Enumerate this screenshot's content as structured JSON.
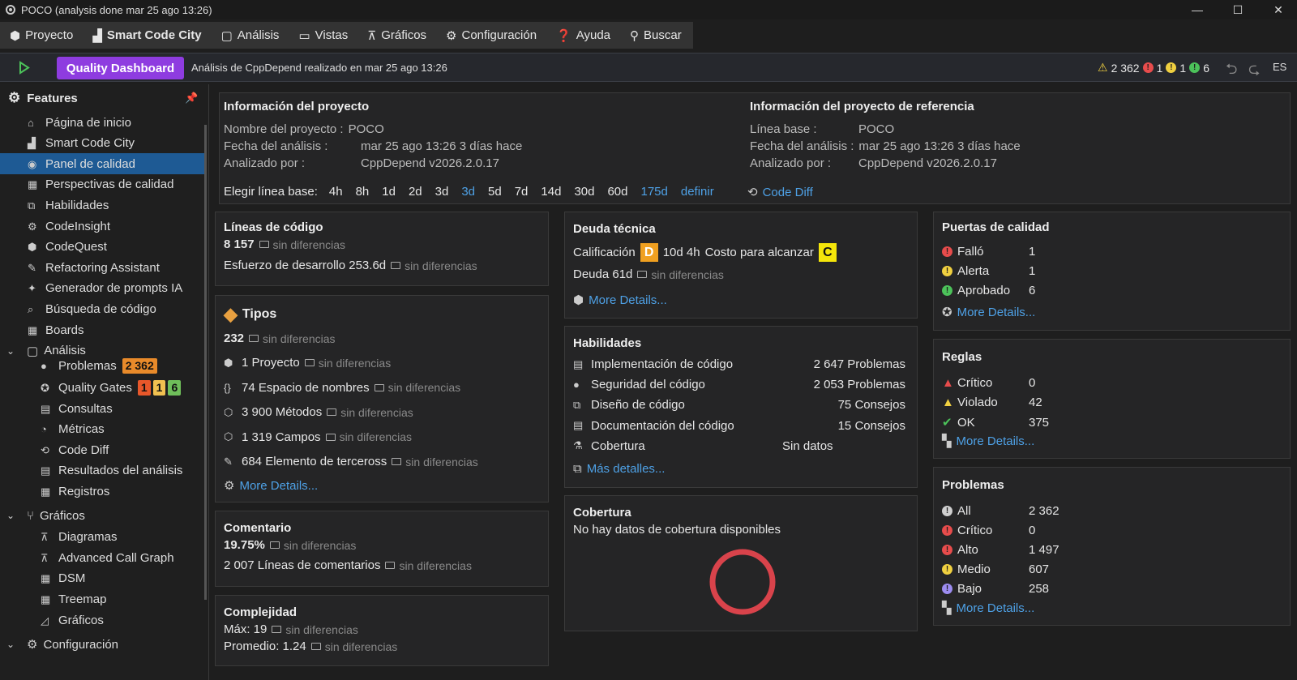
{
  "window": {
    "title": "POCO (analysis done mar 25 ago  13:26)"
  },
  "menu": [
    "Proyecto",
    "Smart Code City",
    "Análisis",
    "Vistas",
    "Gráficos",
    "Configuración",
    "Ayuda",
    "Buscar"
  ],
  "toolbar": {
    "quality_dashboard": "Quality Dashboard",
    "message": "Análisis de CppDepend realizado en mar 25 ago  13:26",
    "warn_count": "2 362",
    "red_count": "1",
    "yellow_count": "1",
    "green_count": "6",
    "lang": "ES"
  },
  "sidebar": {
    "header": "Features",
    "items": [
      "Página de inicio",
      "Smart Code City",
      "Panel de calidad",
      "Perspectivas de calidad",
      "Habilidades",
      "CodeInsight",
      "CodeQuest",
      "Refactoring Assistant",
      "Generador de prompts IA",
      "Búsqueda de código",
      "Boards"
    ],
    "analysis_group": "Análisis",
    "analysis_items": [
      "Problemas",
      "Quality Gates",
      "Consultas",
      "Métricas",
      "Code Diff",
      "Resultados del análisis",
      "Registros"
    ],
    "problems_badge": "2 362",
    "gates_badges": [
      "1",
      "1",
      "6"
    ],
    "graphs_group": "Gráficos",
    "graphs_items": [
      "Diagramas",
      "Advanced Call Graph",
      "DSM",
      "Treemap",
      "Gráficos"
    ],
    "config_group": "Configuración"
  },
  "project": {
    "title": "Información del proyecto",
    "name_label": "Nombre del proyecto :",
    "name_value": "POCO",
    "date_label": "Fecha del análisis :",
    "date_value": "mar 25 ago  13:26 3 días hace",
    "by_label": "Analizado por :",
    "by_value": "CppDepend v2026.2.0.17",
    "ref_title": "Información del proyecto de referencia",
    "base_label": "Línea base :",
    "base_value": "POCO",
    "ref_date_label": "Fecha del análisis :",
    "ref_date_value": "mar 25 ago  13:26 3 días hace",
    "ref_by_label": "Analizado por :",
    "ref_by_value": "CppDepend v2026.2.0.17",
    "baseline_label": "Elegir línea base:",
    "baselines": [
      "4h",
      "8h",
      "1d",
      "2d",
      "3d",
      "3d",
      "5d",
      "7d",
      "14d",
      "30d",
      "60d",
      "175d",
      "definir"
    ],
    "code_diff": "Code Diff"
  },
  "loc": {
    "title": "Líneas de código",
    "value": "8 157",
    "nodiff": "sin diferencias",
    "effort": "Esfuerzo de desarrollo 253.6d",
    "effort_nodiff": "sin diferencias"
  },
  "types": {
    "title": "Tipos",
    "value": "232",
    "nodiff": "sin diferencias",
    "rows": [
      {
        "text": "1 Proyecto",
        "nd": "sin diferencias"
      },
      {
        "text": "74 Espacio de nombres",
        "nd": "sin diferencias"
      },
      {
        "text": "3 900 Métodos",
        "nd": "sin diferencias"
      },
      {
        "text": "1 319 Campos",
        "nd": "sin diferencias"
      },
      {
        "text": "684 Elemento de terceross",
        "nd": "sin diferencias"
      }
    ],
    "more": "More Details..."
  },
  "comment": {
    "title": "Comentario",
    "value": "19.75%",
    "nodiff": "sin diferencias",
    "lines": "2 007 Líneas de comentarios",
    "lines_nd": "sin diferencias"
  },
  "complexity": {
    "title": "Complejidad",
    "max": "Máx: 19",
    "max_nd": "sin diferencias",
    "avg": "Promedio: 1.24",
    "avg_nd": "sin diferencias"
  },
  "debt": {
    "title": "Deuda técnica",
    "rating_label": "Calificación",
    "grade": "D",
    "time": "10d  4h",
    "cost_label": "Costo para alcanzar",
    "target": "C",
    "debt": "Deuda 61d",
    "debt_nd": "sin diferencias",
    "more": "More Details..."
  },
  "skills": {
    "title": "Habilidades",
    "rows": [
      {
        "label": "Implementación de código",
        "value": "2 647 Problemas"
      },
      {
        "label": "Seguridad del código",
        "value": "2 053 Problemas"
      },
      {
        "label": "Diseño de código",
        "value": "75 Consejos"
      },
      {
        "label": "Documentación del código",
        "value": "15 Consejos"
      },
      {
        "label": "Cobertura",
        "value": "Sin datos"
      }
    ],
    "more": "Más detalles..."
  },
  "coverage": {
    "title": "Cobertura",
    "message": "No hay datos de cobertura disponibles"
  },
  "gates": {
    "title": "Puertas de calidad",
    "rows": [
      {
        "label": "Falló",
        "value": "1"
      },
      {
        "label": "Alerta",
        "value": "1"
      },
      {
        "label": "Aprobado",
        "value": "6"
      }
    ],
    "more": "More Details..."
  },
  "rules": {
    "title": "Reglas",
    "rows": [
      {
        "label": "Crítico",
        "value": "0"
      },
      {
        "label": "Violado",
        "value": "42"
      },
      {
        "label": "OK",
        "value": "375"
      }
    ],
    "more": "More Details..."
  },
  "problems": {
    "title": "Problemas",
    "rows": [
      {
        "label": "All",
        "value": "2 362"
      },
      {
        "label": "Crítico",
        "value": "0"
      },
      {
        "label": "Alto",
        "value": "1 497"
      },
      {
        "label": "Medio",
        "value": "607"
      },
      {
        "label": "Bajo",
        "value": "258"
      }
    ],
    "more": "More Details..."
  },
  "colors": {
    "accent": "#8e3ce0",
    "link": "#4ea1e6",
    "red": "#e74c4c",
    "yellow": "#f0d040",
    "green": "#4cc25a",
    "orange": "#e88a2a",
    "grade_d": "#f0a020",
    "grade_c": "#f5e60a"
  }
}
